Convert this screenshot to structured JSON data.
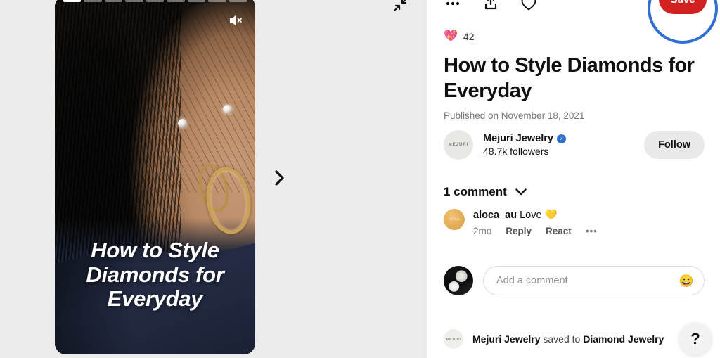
{
  "story": {
    "progress_segments": 9,
    "active_segment_index": 0,
    "mute_icon": "speaker-muted-icon",
    "caption": "How to Style Diamonds for Everyday",
    "next_icon": "chevron-right-icon",
    "expand_icon": "collapse-diagonal-icon"
  },
  "top_actions": [
    {
      "name": "more-options-icon",
      "glyph": "ellipsis"
    },
    {
      "name": "share-icon",
      "glyph": "upload"
    },
    {
      "name": "favorite-icon",
      "glyph": "heart-outline"
    }
  ],
  "save": {
    "label": "Save",
    "button_color": "#d32020",
    "focus_ring_color": "#2f6fd0"
  },
  "reaction": {
    "emoji": "💖",
    "count": "42"
  },
  "pin": {
    "title": "How to Style Diamonds for Everyday",
    "published": "Published on November 18, 2021"
  },
  "creator": {
    "avatar_text": "MEJURI",
    "name": "Mejuri Jewelry",
    "verified_glyph": "✓",
    "followers": "48.7k followers",
    "follow_label": "Follow"
  },
  "comments": {
    "header": "1 comment",
    "chevron_icon": "chevron-down-icon",
    "items": [
      {
        "avatar_text": "aloca",
        "username": "aloca_au",
        "text": " Love 💛",
        "time": "2mo",
        "reply_label": "Reply",
        "react_label": "React",
        "more_label": "•••"
      }
    ]
  },
  "composer": {
    "placeholder": "Add a comment",
    "value": "",
    "emoji_glyph": "😀"
  },
  "saved_to": {
    "avatar_text": "MEJURI",
    "board_owner": "Mejuri Jewelry",
    "middle": " saved to ",
    "board_name": "Diamond Jewelry"
  },
  "help": {
    "label": "?"
  }
}
